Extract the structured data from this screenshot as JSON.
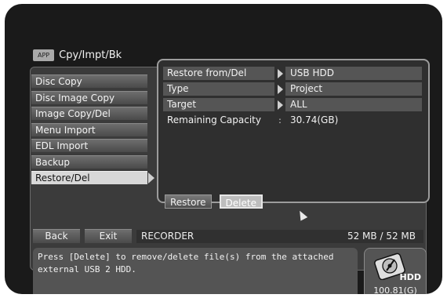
{
  "header": {
    "app_badge": "APP",
    "title": "Cpy/Impt/Bk"
  },
  "menu": [
    {
      "label": "Disc Copy"
    },
    {
      "label": "Disc Image Copy"
    },
    {
      "label": "Image Copy/Del"
    },
    {
      "label": "Menu Import"
    },
    {
      "label": "EDL Import"
    },
    {
      "label": "Backup"
    },
    {
      "label": "Restore/Del",
      "active": true
    }
  ],
  "settings": {
    "restore_from": {
      "label": "Restore from/Del",
      "value": "USB HDD"
    },
    "type": {
      "label": "Type",
      "value": "Project"
    },
    "target": {
      "label": "Target",
      "value": "ALL"
    },
    "remaining": {
      "label": "Remaining Capacity",
      "value": "30.74(GB)"
    }
  },
  "actions": {
    "restore": "Restore",
    "delete": "Delete"
  },
  "nav": {
    "back": "Back",
    "exit": "Exit"
  },
  "device": {
    "name": "RECORDER",
    "used": "52 MB",
    "separator": "/",
    "total": "52 MB"
  },
  "help": {
    "text": "Press [Delete] to remove/delete file(s) from the attached external USB 2 HDD."
  },
  "hdd": {
    "label": "HDD",
    "capacity": "100.81(G)",
    "icon": "hard-disk-icon"
  }
}
